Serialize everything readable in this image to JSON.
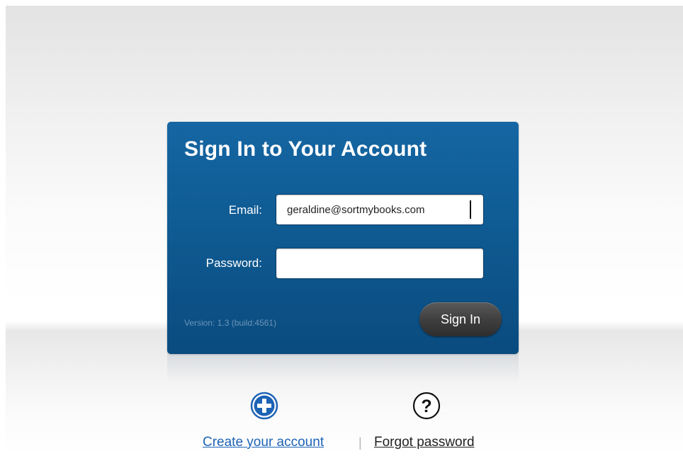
{
  "login_card": {
    "title": "Sign In to Your Account",
    "email_label": "Email:",
    "email_value": "geraldine@sortmybooks.com",
    "password_label": "Password:",
    "password_value": "",
    "version_text": "Version: 1.3 (build:4561)",
    "signin_label": "Sign In"
  },
  "actions": {
    "create_account_label": "Create your account",
    "create_account_icon": "plus-circle-icon",
    "separator": "|",
    "forgot_password_label": "Forgot password",
    "forgot_password_icon": "question-circle-icon"
  },
  "colors": {
    "card_blue": "#0f5b93",
    "link_blue": "#1d63b5",
    "button_dark": "#3f3f3f"
  }
}
